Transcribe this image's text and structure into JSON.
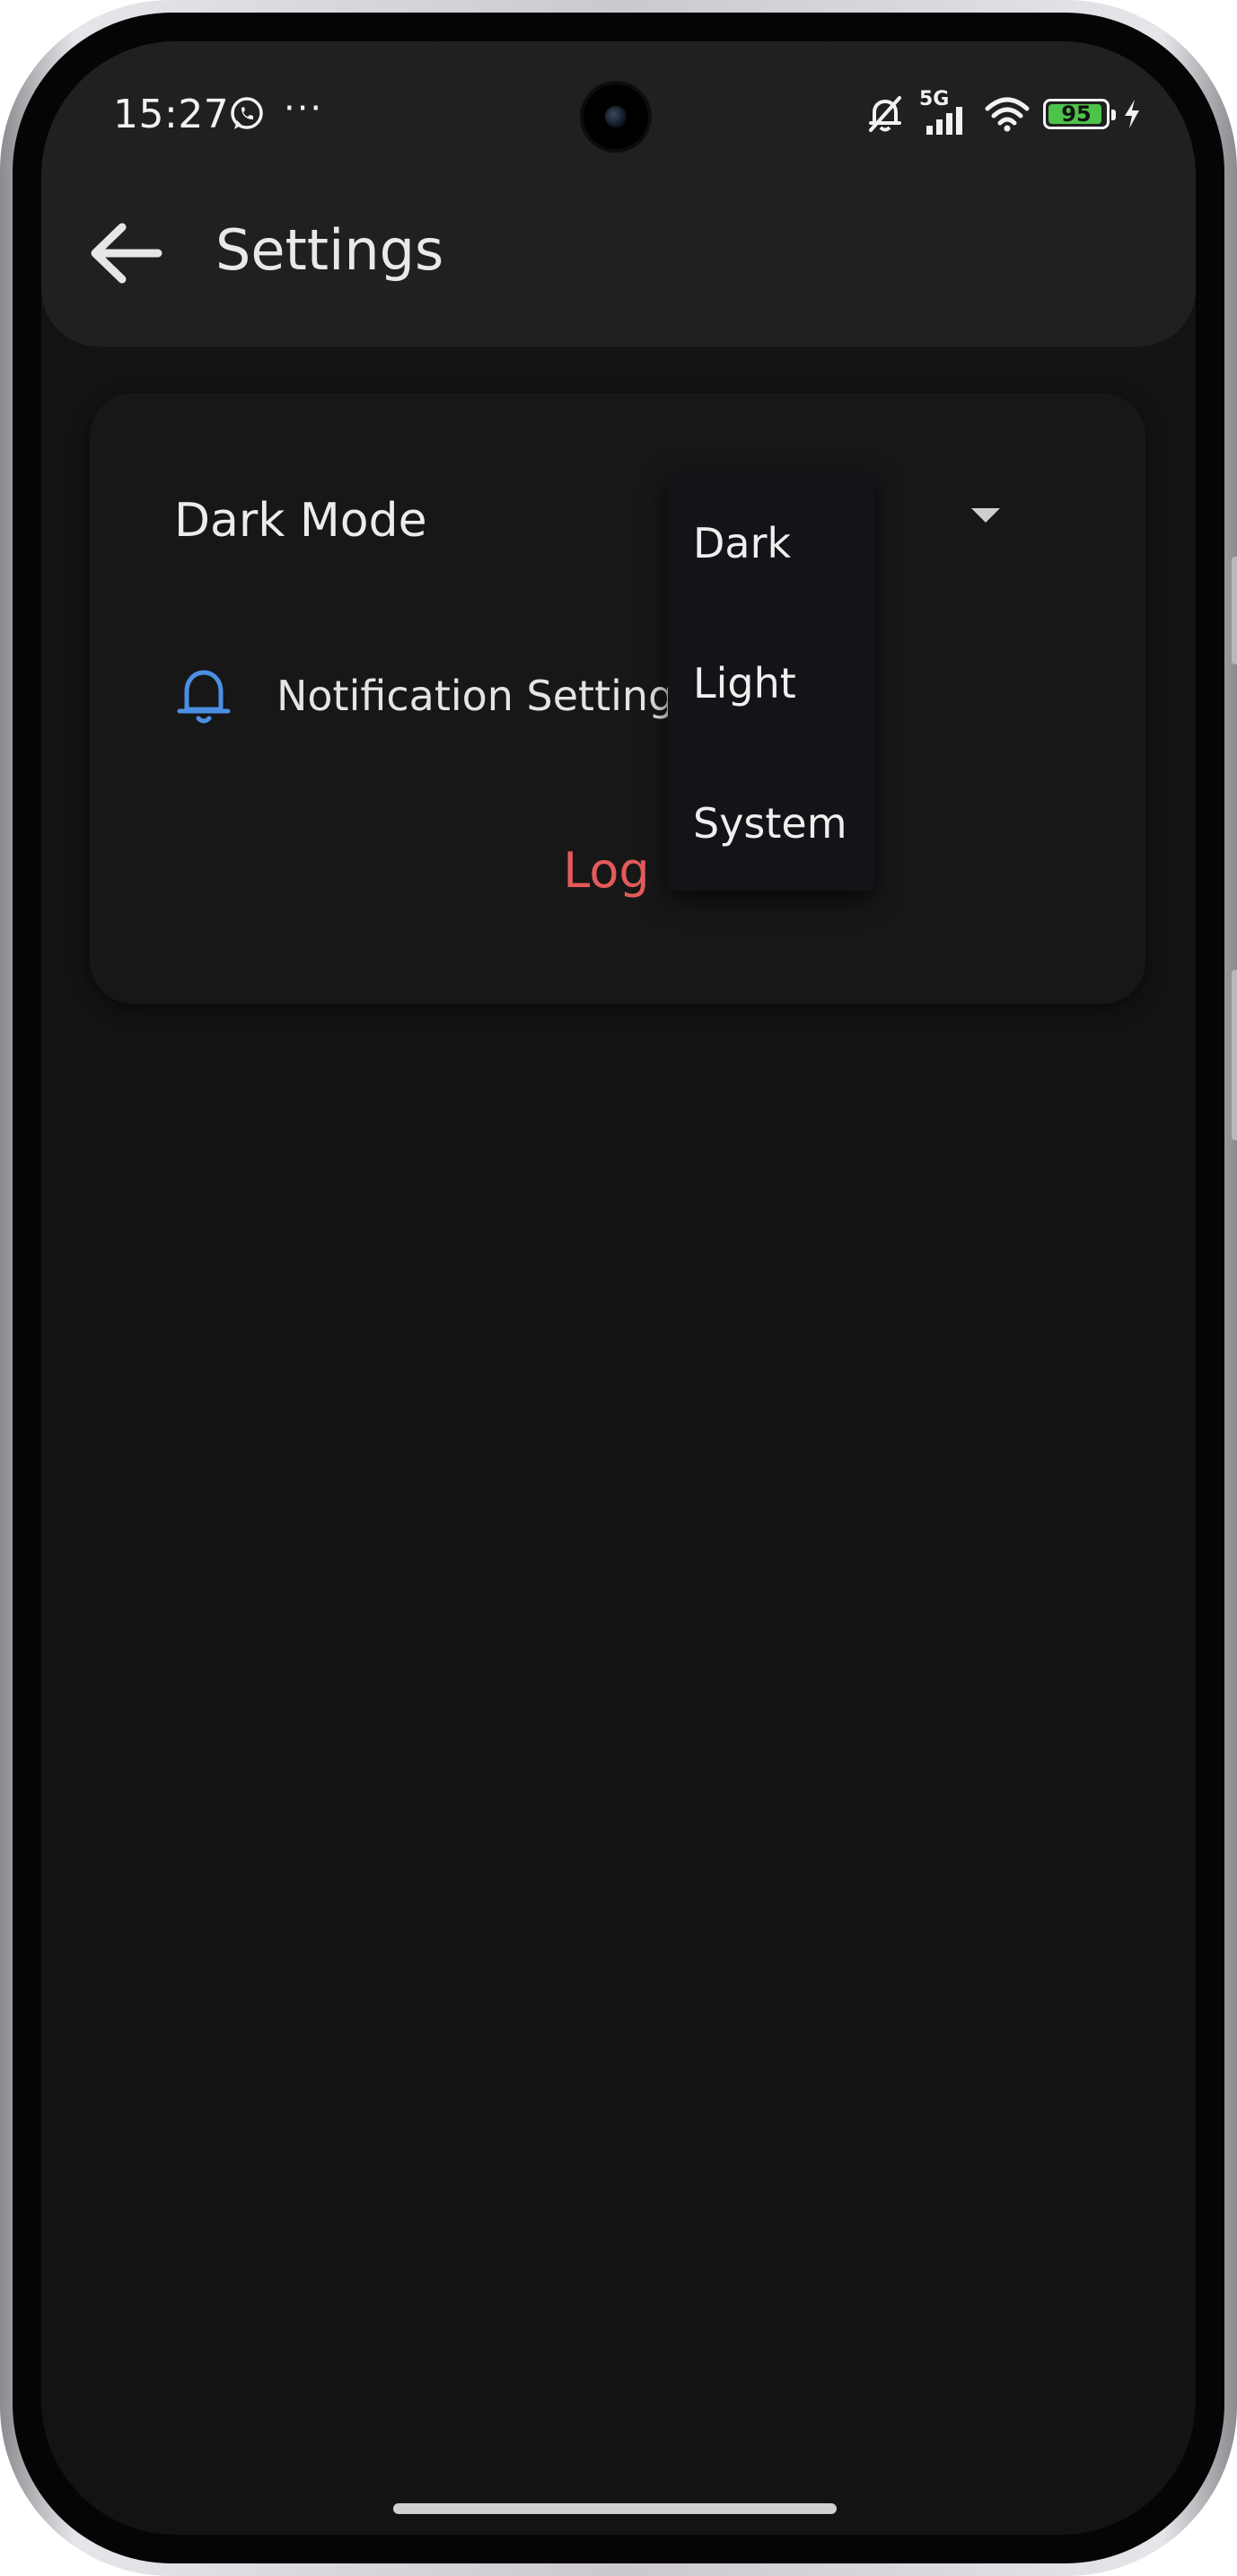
{
  "status_bar": {
    "time": "15:27",
    "dots": "···",
    "network": "5G",
    "battery_level": "95",
    "battery_fraction": 0.95,
    "battery_color": "#4ec34a"
  },
  "app_bar": {
    "title": "Settings"
  },
  "settings": {
    "dark_mode_label": "Dark Mode",
    "notification_label": "Notification Settings",
    "logout_label": "Log Out"
  },
  "theme_menu": {
    "options": [
      "Dark",
      "Light",
      "System"
    ]
  },
  "colors": {
    "background": "#131313",
    "accent_icon": "#4a90e2",
    "danger": "#e45a5a"
  },
  "icons": {
    "back": "arrow-left-icon",
    "notification": "bell-icon",
    "dropdown": "caret-down-icon",
    "chat": "whatsapp-icon",
    "mute": "bell-off-icon",
    "signal": "signal-icon",
    "wifi": "wifi-icon",
    "battery": "battery-icon",
    "charging": "bolt-icon"
  }
}
